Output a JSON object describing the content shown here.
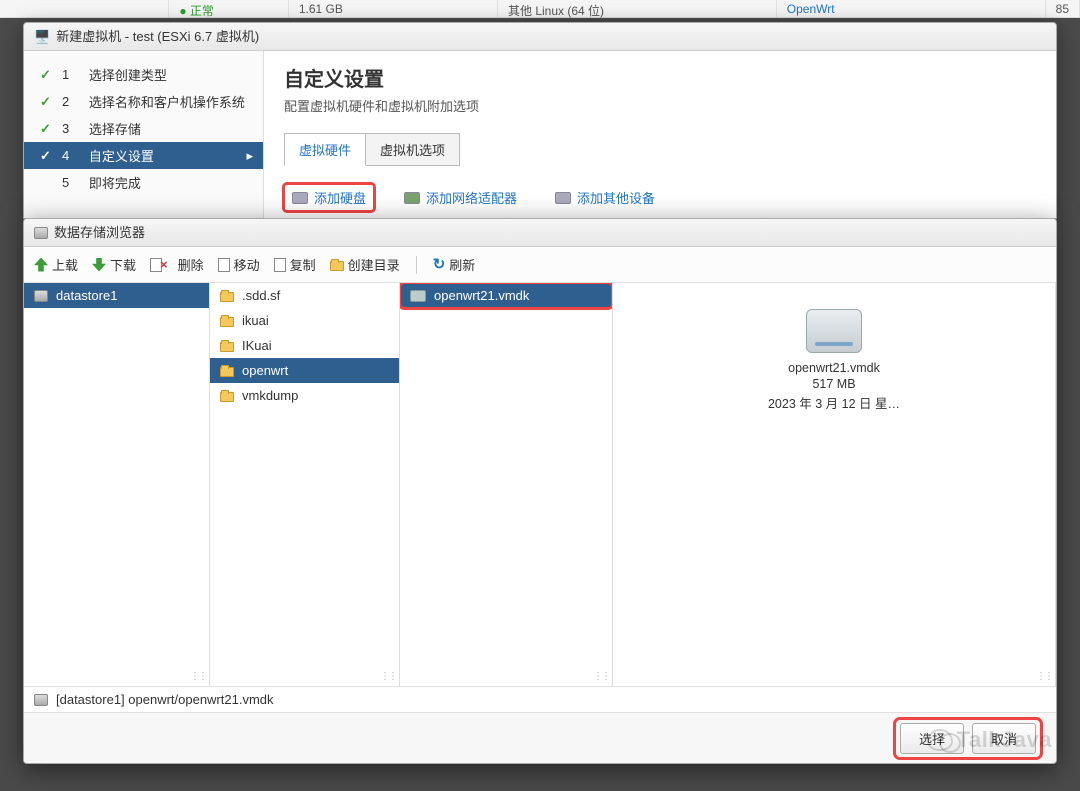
{
  "bg_row": {
    "status": "正常",
    "size": "1.61 GB",
    "os": "其他 Linux (64 位)",
    "guest": "OpenWrt",
    "tail": "85"
  },
  "wizard": {
    "window_title": "新建虚拟机 - test (ESXi 6.7 虚拟机)",
    "steps": [
      {
        "num": "1",
        "label": "选择创建类型",
        "done": true
      },
      {
        "num": "2",
        "label": "选择名称和客户机操作系统",
        "done": true
      },
      {
        "num": "3",
        "label": "选择存储",
        "done": true
      },
      {
        "num": "4",
        "label": "自定义设置",
        "active": true
      },
      {
        "num": "5",
        "label": "即将完成",
        "pending": true
      }
    ],
    "section_title": "自定义设置",
    "section_sub": "配置虚拟机硬件和虚拟机附加选项",
    "tabs": [
      {
        "label": "虚拟硬件",
        "active": true
      },
      {
        "label": "虚拟机选项"
      }
    ],
    "actions": [
      {
        "label": "添加硬盘",
        "highlight": true
      },
      {
        "label": "添加网络适配器"
      },
      {
        "label": "添加其他设备"
      }
    ]
  },
  "browser": {
    "title": "数据存储浏览器",
    "toolbar": [
      {
        "label": "上载",
        "icon": "up"
      },
      {
        "label": "下载",
        "icon": "dn"
      },
      {
        "label": "删除",
        "icon": "del"
      },
      {
        "label": "移动",
        "icon": "doc"
      },
      {
        "label": "复制",
        "icon": "doc"
      },
      {
        "label": "创建目录",
        "icon": "folder"
      },
      {
        "sep": true
      },
      {
        "label": "刷新",
        "icon": "refresh"
      }
    ],
    "col1": [
      {
        "label": "datastore1",
        "selected": true,
        "icon": "db"
      }
    ],
    "col2": [
      {
        "label": ".sdd.sf"
      },
      {
        "label": "ikuai"
      },
      {
        "label": "IKuai"
      },
      {
        "label": "openwrt",
        "selected": true
      },
      {
        "label": "vmkdump"
      }
    ],
    "col3": [
      {
        "label": "openwrt21.vmdk",
        "selected": true,
        "highlight": true,
        "file": true
      }
    ],
    "preview": {
      "name": "openwrt21.vmdk",
      "size": "517 MB",
      "date": "2023 年 3 月 12 日 星…"
    },
    "path": "[datastore1] openwrt/openwrt21.vmdk",
    "buttons": {
      "select": "选择",
      "cancel": "取消"
    }
  },
  "watermark": "TalkJava"
}
